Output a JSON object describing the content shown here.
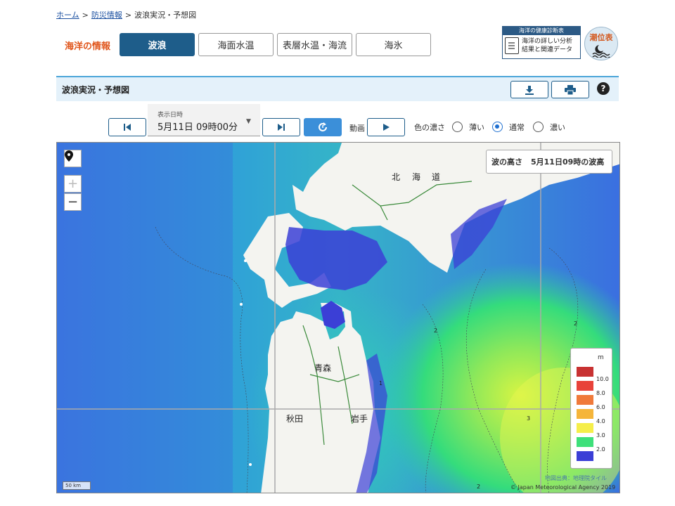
{
  "breadcrumb": {
    "home": "ホーム",
    "sep1": ">",
    "disaster": "防災情報",
    "sep2": ">",
    "current": "波浪実況・予想図"
  },
  "section_label": "海洋の情報",
  "tabs": [
    {
      "label": "波浪",
      "active": true
    },
    {
      "label": "海面水温",
      "active": false
    },
    {
      "label": "表層水温・海流",
      "active": false
    },
    {
      "label": "海氷",
      "active": false
    }
  ],
  "health_banner": {
    "title": "海洋の健康診断表",
    "line1": "海洋の詳しい分析",
    "line2": "結果と関連データ"
  },
  "tide_link": "潮位表",
  "title_bar": {
    "title": "波浪実況・予想図"
  },
  "controls": {
    "datetime_label": "表示日時",
    "datetime_value": "5月11日 09時00分",
    "animation_label": "動画",
    "depth_label": "色の濃さ",
    "depth_options": [
      "薄い",
      "通常",
      "濃い"
    ],
    "depth_selected": "通常"
  },
  "map": {
    "info_label": "波の高さ",
    "info_time": "5月11日09時の波高",
    "place_names": [
      "北",
      "海",
      "道",
      "青森",
      "秋田",
      "岩手"
    ],
    "scale": "50 km",
    "attribution_tiles": "地図出典：地理院タイル",
    "attribution_jma": "© Japan Meteorological Agency 2019",
    "contour_labels": [
      "2",
      "2",
      "2",
      "1",
      "3"
    ],
    "legend": {
      "unit": "m",
      "items": [
        {
          "label": "10.0",
          "color": "#c83232"
        },
        {
          "label": "8.0",
          "color": "#e8433a"
        },
        {
          "label": "6.0",
          "color": "#f07a3a"
        },
        {
          "label": "4.0",
          "color": "#f5b53a"
        },
        {
          "label": "3.0",
          "color": "#f5ee4a"
        },
        {
          "label": "2.0",
          "color": "#3ee07a"
        },
        {
          "label": "",
          "color": "#3b3fd6"
        }
      ]
    }
  }
}
